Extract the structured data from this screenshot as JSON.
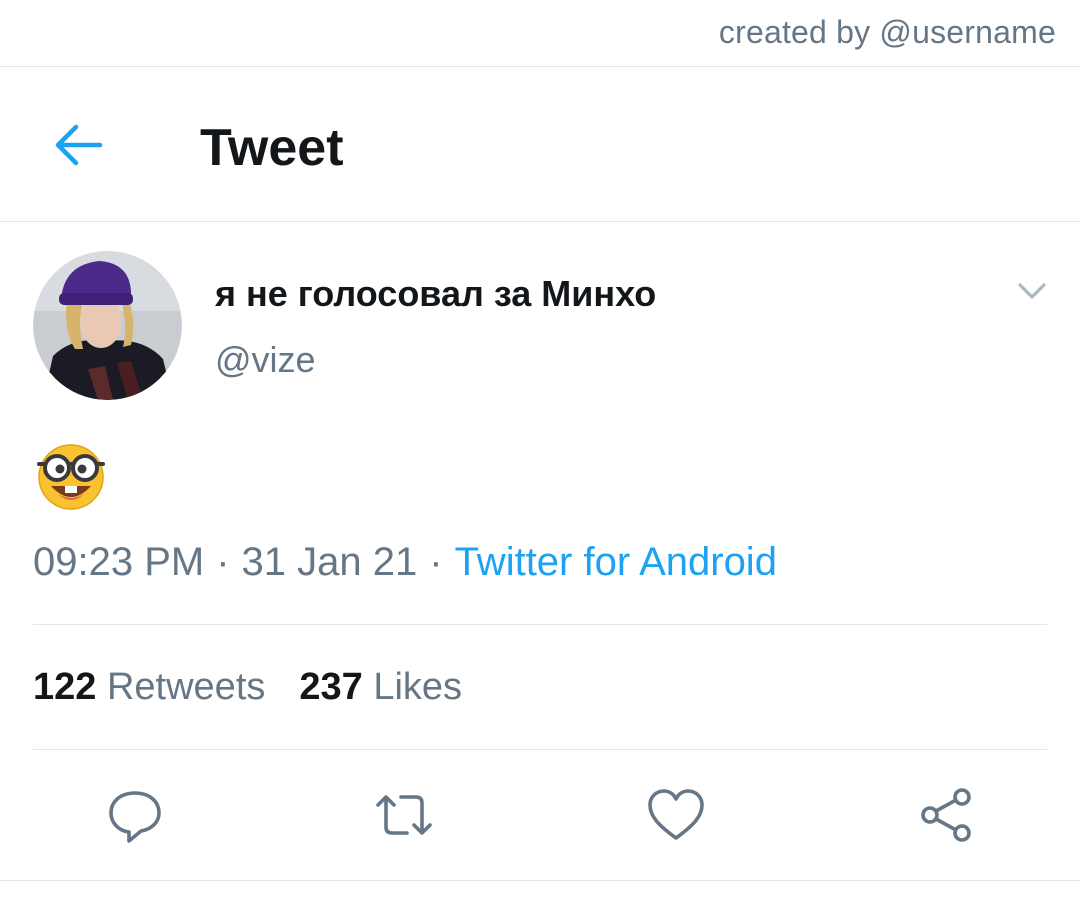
{
  "credit": "created by @username",
  "header": {
    "title": "Tweet"
  },
  "tweet": {
    "display_name": "я не голосовал за Минхо",
    "handle": "@vize",
    "emoji": "nerd-face",
    "time": "09:23 PM",
    "date": "31 Jan 21",
    "source": "Twitter for Android",
    "separator": "·",
    "retweets_count": "122",
    "retweets_label": "Retweets",
    "likes_count": "237",
    "likes_label": "Likes"
  },
  "colors": {
    "accent": "#1da1f2",
    "secondary_text": "#657786",
    "divider": "#e1e8ed"
  },
  "icons": [
    "back-arrow-icon",
    "chevron-down-icon",
    "reply-icon",
    "retweet-icon",
    "like-icon",
    "share-icon"
  ]
}
